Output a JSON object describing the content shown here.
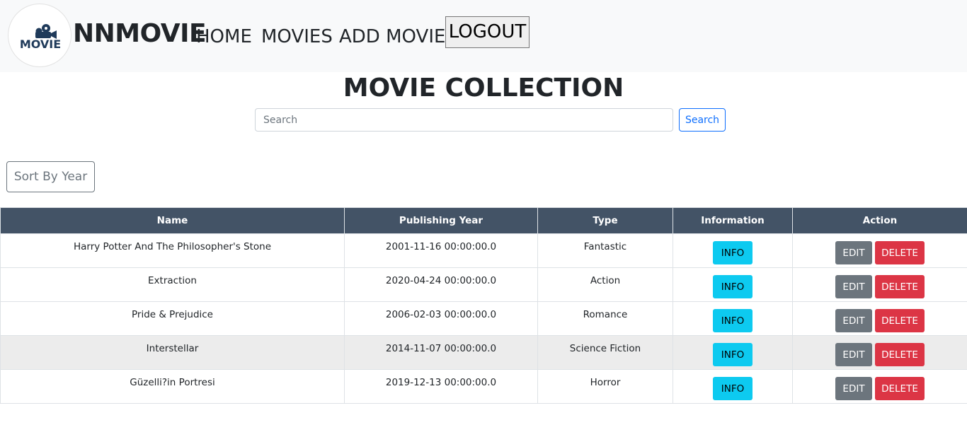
{
  "navbar": {
    "logo_text": "MOVIE",
    "brand": "NNMOVIE",
    "links": [
      "HOME",
      "MOVIES",
      "ADD MOVIE"
    ],
    "logout_label": "LOGOUT"
  },
  "page": {
    "title": "MOVIE COLLECTION"
  },
  "search": {
    "placeholder": "Search",
    "button_label": "Search"
  },
  "sort": {
    "label": "Sort By Year"
  },
  "table": {
    "columns": [
      "Name",
      "Publishing Year",
      "Type",
      "Information",
      "Action"
    ],
    "rows": [
      {
        "name": "Harry Potter And The Philosopher's Stone",
        "year": "2001-11-16 00:00:00.0",
        "type": "Fantastic"
      },
      {
        "name": "Extraction",
        "year": "2020-04-24 00:00:00.0",
        "type": "Action"
      },
      {
        "name": "Pride & Prejudice",
        "year": "2006-02-03 00:00:00.0",
        "type": "Romance"
      },
      {
        "name": "Interstellar",
        "year": "2014-11-07 00:00:00.0",
        "type": "Science Fiction"
      },
      {
        "name": "Güzelli?in Portresi",
        "year": "2019-12-13 00:00:00.0",
        "type": "Horror"
      }
    ],
    "info_label": "INFO",
    "edit_label": "EDIT",
    "delete_label": "DELETE"
  },
  "colors": {
    "header_bg": "#435366",
    "info": "#0dcaf0",
    "edit": "#6c757d",
    "delete": "#dc3545",
    "primary": "#0d6efd"
  }
}
